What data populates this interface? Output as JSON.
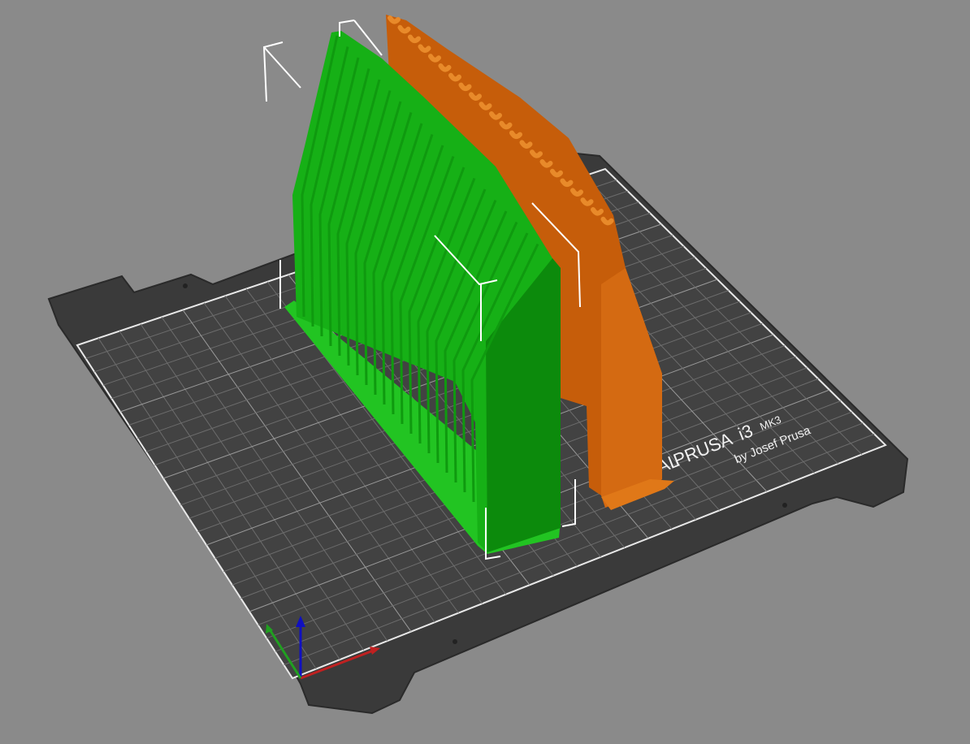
{
  "app": "PrusaSlicer 3D view",
  "colors": {
    "background": "#8a8a8a",
    "bed": "#3a3a3a",
    "bed_grid": "#7a7a7a",
    "bed_border": "#f0f0f0",
    "object_selected": "#1fbf1f",
    "object_other": "#d86a10",
    "bbox": "#ffffff",
    "axis_x": "#c02020",
    "axis_y": "#20a020",
    "axis_z": "#1010c0"
  },
  "bed_label": {
    "brand": "PRUSA",
    "model": "i3",
    "variant": "MK3",
    "byline": "by Josef Prusa",
    "prefix": "ORIGINAL"
  },
  "objects": [
    {
      "name": "selected-object",
      "color": "object_selected",
      "selected": true
    },
    {
      "name": "second-object",
      "color": "object_other",
      "selected": false
    }
  ],
  "axes": [
    "x",
    "y",
    "z"
  ]
}
